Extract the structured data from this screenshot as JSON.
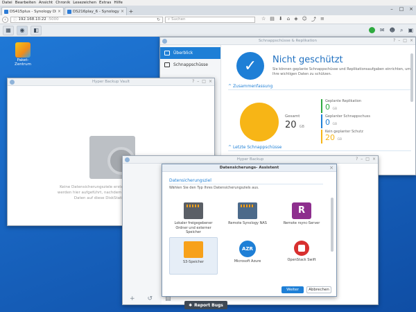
{
  "browser": {
    "menu": [
      "Datei",
      "Bearbeiten",
      "Ansicht",
      "Chronik",
      "Lesezeichen",
      "Extras",
      "Hilfe"
    ],
    "tabs": [
      {
        "label": "DS415plus - Synology Disk..."
      },
      {
        "label": "DS216play_6 - Synology Dis..."
      }
    ],
    "url_host": "192.168.10.22",
    "url_port": ":5000",
    "search_placeholder": "Suchen"
  },
  "desktop": {
    "icons": [
      {
        "label": "Paket-\nZentrum"
      }
    ]
  },
  "vault": {
    "title": "Hyper Backup Vault",
    "empty_text": "Keine Datensicherungsziele erstellt. Datensicherungsziele werden hier aufgeführt, nachdem eine Datensicherung Ihrer Daten auf diese DiskStation erstellt wurde."
  },
  "snapshot": {
    "title": "Schnappschüsse & Replikation",
    "nav": [
      {
        "label": "Überblick"
      },
      {
        "label": "Schnappschüsse"
      }
    ],
    "status_title": "Nicht geschützt",
    "status_desc": "Sie können geplante Schnappschüsse und Replikationsaufgaben einrichten, um Ihre wichtigen Daten zu schützen.",
    "section_summary": "Zusammenfassung",
    "total_label": "Gesamt",
    "total_value": "20",
    "total_unit": "GB",
    "legend": [
      {
        "label": "Geplante Replikation",
        "value": "0",
        "unit": "GB",
        "color": "#2eaa3f"
      },
      {
        "label": "Geplanter Schnappschuss",
        "value": "0",
        "unit": "GB",
        "color": "#1e7fd6"
      },
      {
        "label": "Kein geplanter Schutz",
        "value": "20",
        "unit": "GB",
        "color": "#f7b516"
      }
    ],
    "section_recent": "Letzte Schnappschüsse"
  },
  "hyperbackup": {
    "title": "Hyper Backup",
    "report_label": "Report Bugs"
  },
  "wizard": {
    "title": "Datensicherungs- Assistent",
    "subtitle": "Datensicherungsziel",
    "hint": "Wählen Sie den Typ Ihres Datensicherungsziels aus.",
    "options": [
      {
        "label": "Lokaler freigegebener Ordner und externer Speicher",
        "icon": "local-nas-icon"
      },
      {
        "label": "Remote Synology NAS",
        "icon": "remote-nas-icon"
      },
      {
        "label": "Remote rsync-Server",
        "icon": "rsync-icon",
        "glyph": "R"
      },
      {
        "label": "S3-Speicher",
        "icon": "s3-icon"
      },
      {
        "label": "Microsoft Azure",
        "icon": "azure-icon",
        "glyph": "AZR"
      },
      {
        "label": "OpenStack Swift",
        "icon": "openstack-icon"
      }
    ],
    "next_label": "Weiter",
    "cancel_label": "Abbrechen"
  }
}
